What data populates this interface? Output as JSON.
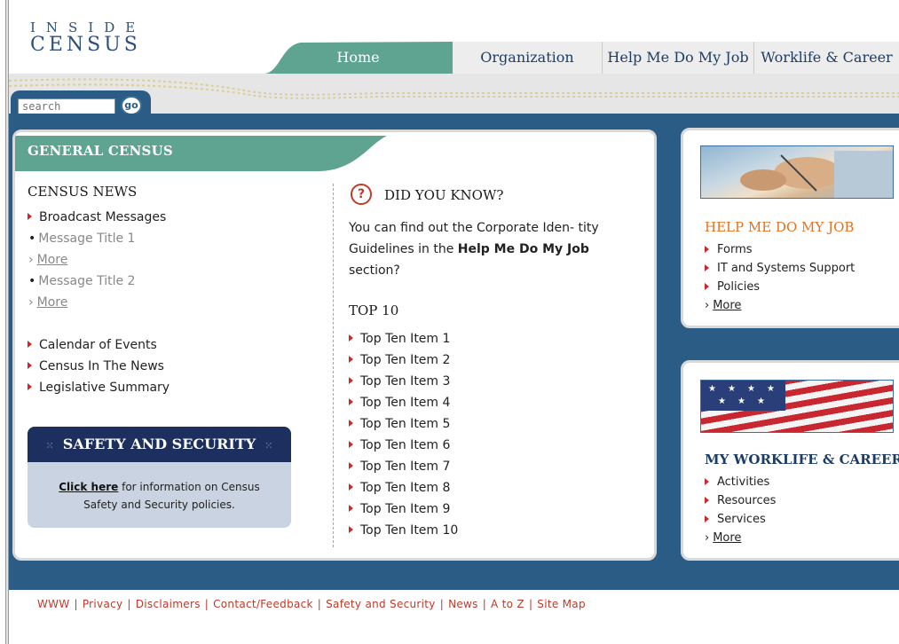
{
  "logo": {
    "line1": "INSIDE",
    "line2": "CENSUS"
  },
  "nav": {
    "tabs": [
      "Home",
      "Organization",
      "Help Me Do My Job",
      "Worklife & Career"
    ]
  },
  "search": {
    "placeholder": "search",
    "go_label": "go"
  },
  "general": {
    "band_title": "GENERAL CENSUS",
    "news_heading": "CENSUS NEWS",
    "broadcast": "Broadcast Messages",
    "message1": "Message Title 1",
    "message2": "Message Title 2",
    "more": "More",
    "links": [
      "Calendar of Events",
      "Census In The News",
      "Legislative Summary"
    ]
  },
  "safety": {
    "title": "SAFETY AND SECURITY",
    "click_here": "Click here",
    "text_line1": " for information on Census",
    "text_line2": "Safety and Security policies."
  },
  "did_you_know": {
    "icon": "?",
    "heading": "DID YOU KNOW?",
    "text_before": "You can find out the Corporate Iden- tity Guidelines in the ",
    "bold": "Help Me Do My Job",
    "text_after": " section?"
  },
  "top10": {
    "heading": "TOP 10",
    "items": [
      "Top Ten Item 1",
      "Top Ten Item 2",
      "Top Ten Item 3",
      "Top Ten Item 4",
      "Top Ten Item 5",
      "Top Ten Item 6",
      "Top Ten Item 7",
      "Top Ten Item 8",
      "Top Ten Item 9",
      "Top Ten Item 10"
    ]
  },
  "help_panel": {
    "heading": "HELP ME DO MY JOB",
    "items": [
      "Forms",
      "IT and Systems Support",
      "Policies"
    ],
    "more": "More"
  },
  "worklife_panel": {
    "heading": "MY WORKLIFE & CAREER",
    "items": [
      "Activities",
      "Resources",
      "Services"
    ],
    "more": "More"
  },
  "footer": {
    "links": [
      "WWW",
      "Privacy",
      "Disclaimers",
      "Contact/Feedback",
      "Safety and Security",
      "News",
      "A to Z",
      "Site Map"
    ],
    "separator": "|"
  },
  "colors": {
    "navy": "#2b5c86",
    "teal": "#5fa491",
    "accent_red": "#c0392b",
    "orange": "#e8701d"
  }
}
